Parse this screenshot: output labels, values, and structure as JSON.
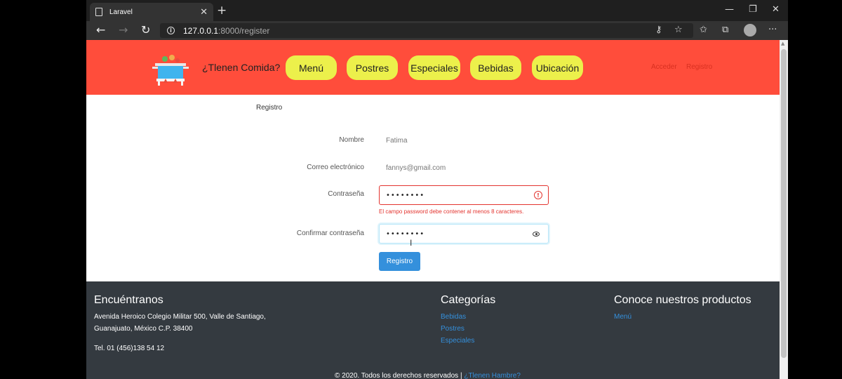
{
  "browser": {
    "tab_title": "Laravel",
    "url_host": "127.0.0.1",
    "url_rest": ":8000/register"
  },
  "header": {
    "brand": "¿Tlenen Comida?",
    "nav": [
      "Menú",
      "Postres",
      "Especiales",
      "Bebidas",
      "Ubicación"
    ],
    "login": "Acceder",
    "register": "Registro"
  },
  "form": {
    "breadcrumb": "Registro",
    "name_label": "Nombre",
    "name_value": "Fatima",
    "email_label": "Correo electrónico",
    "email_value": "fannys@gmail.com",
    "password_label": "Contraseña",
    "password_value": "••••••••",
    "password_error": "El campo password debe contener al menos 8 caracteres.",
    "confirm_label": "Confirmar contraseña",
    "confirm_value": "••••••••",
    "submit_label": "Registro"
  },
  "footer": {
    "find_title": "Encuéntranos",
    "address_line1": "Avenida Heroico Colegio Militar 500, Valle de Santiago,",
    "address_line2": "Guanajuato, México C.P. 38400",
    "phone": "Tel. 01 (456)138 54 12",
    "categories_title": "Categorías",
    "categories": [
      "Bebidas",
      "Postres",
      "Especiales"
    ],
    "products_title": "Conoce nuestros productos",
    "products": [
      "Menú"
    ],
    "copyright": "© 2020. Todos los derechos reservados |",
    "copyright_link": "¿Tlenen Hambre?"
  },
  "colors": {
    "header_bg": "#ff4d3b",
    "nav_pill": "#ecf04b",
    "primary": "#3490dc",
    "error": "#e3342f",
    "footer_bg": "#343a40"
  }
}
